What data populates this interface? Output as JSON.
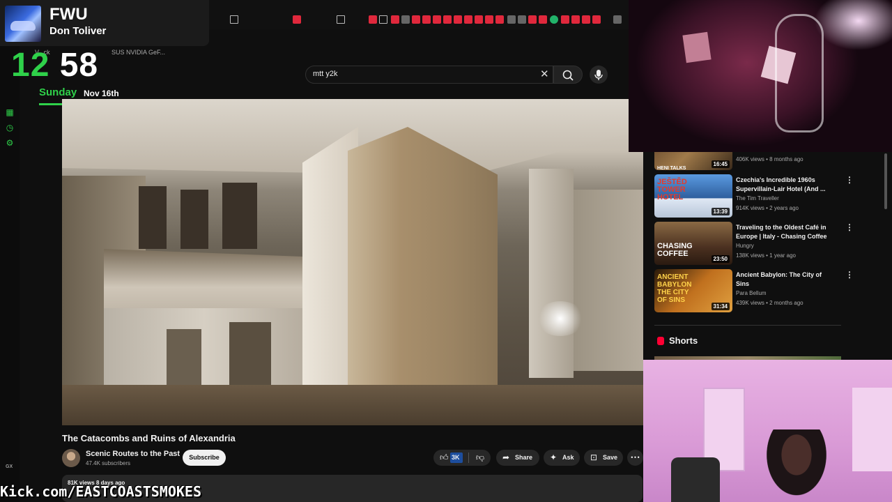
{
  "music_widget": {
    "title": "FWU",
    "artist": "Don Toliver"
  },
  "clock_widget": {
    "hour": "12",
    "minutes": "58",
    "day": "Sunday",
    "date": "Nov 16th"
  },
  "bookmarks": [
    {
      "label": "V...ck"
    },
    {
      "label": "SUS NVIDIA GeF..."
    }
  ],
  "search": {
    "value": "mtt y2k"
  },
  "video": {
    "title": "The Catacombs and Ruins of Alexandria",
    "channel": "Scenic Routes to the Past",
    "subscribers": "47.4K subscribers",
    "subscribe_label": "Subscribe",
    "likes": "3K",
    "share_label": "Share",
    "ask_label": "Ask",
    "save_label": "Save",
    "views": "81K views",
    "age": "8 days ago"
  },
  "overlay": {
    "kick_text": "Kick.com/EASTCOASTSMOKES"
  },
  "sidebar_app": {
    "gx_label": "GX"
  },
  "recommendations": [
    {
      "title": "",
      "channel": "",
      "meta": "406K views • 8 months ago",
      "duration": "16:45",
      "thumb_text": "HENI TALKS",
      "thumb_color": "#7a5a3a"
    },
    {
      "title": "Czechia's Incredible 1960s Supervillain-Lair Hotel (And ...",
      "channel": "The Tim Traveller",
      "meta": "914K views • 2 years ago",
      "duration": "13:39",
      "thumb_text": "JEŠTĚD TOWER HOTEL",
      "thumb_color": "#3a6fb0"
    },
    {
      "title": "Traveling to the Oldest Café in Europe | Italy - Chasing Coffee",
      "channel": "Hungry",
      "meta": "138K views • 1 year ago",
      "duration": "23:50",
      "thumb_text": "CHASING COFFEE",
      "thumb_color": "#6a4a2e"
    },
    {
      "title": "Ancient Babylon: The City of Sins",
      "channel": "Para Bellum",
      "meta": "439K views • 2 months ago",
      "duration": "31:34",
      "thumb_text": "ANCIENT BABYLON THE CITY OF SINS",
      "thumb_color": "#a05a1e"
    }
  ],
  "shorts": {
    "title": "Shorts"
  }
}
